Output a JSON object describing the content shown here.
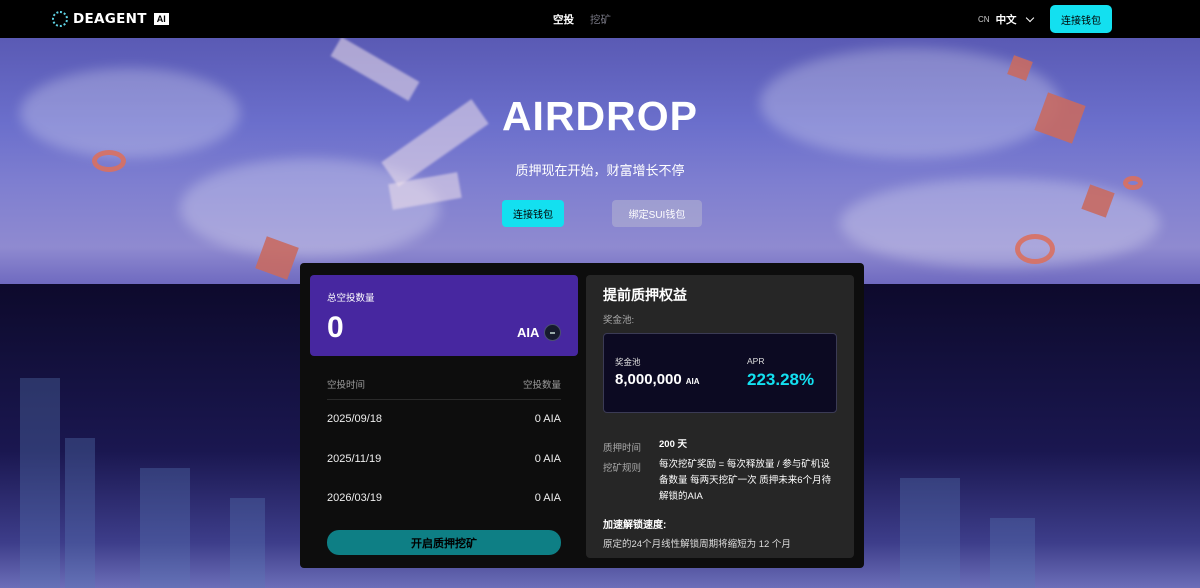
{
  "header": {
    "brand": "DEAGENT",
    "brand_badge": "AI",
    "nav": [
      "空投",
      "挖矿"
    ],
    "lang_code": "CN",
    "lang_name": "中文",
    "connect_label": "连接钱包"
  },
  "hero": {
    "title": "AIRDROP",
    "subtitle": "质押现在开始，财富增长不停",
    "primary_button": "连接钱包",
    "secondary_button": "绑定SUI钱包"
  },
  "airdrop_card": {
    "total_label": "总空投数量",
    "total_value": "0",
    "unit": "AIA",
    "col_time": "空投时间",
    "col_amount": "空投数量",
    "rows": [
      {
        "date": "2025/09/18",
        "amount": "0 AIA"
      },
      {
        "date": "2025/11/19",
        "amount": "0 AIA"
      },
      {
        "date": "2026/03/19",
        "amount": "0 AIA"
      }
    ],
    "stake_button": "开启质押挖矿"
  },
  "benefits": {
    "title": "提前质押权益",
    "pool_label": "奖金池:",
    "pool_key": "奖金池",
    "pool_value": "8,000,000",
    "pool_unit": "AIA",
    "apr_key": "APR",
    "apr_value": "223.28%",
    "stake_time_key": "质押时间",
    "stake_time_value": "200 天",
    "rule_key": "挖矿规则",
    "rule_value": "每次挖矿奖励 = 每次释放量 / 参与矿机设备数量 每两天挖矿一次 质押未来6个月待解锁的AIA",
    "accel_title": "加速解锁速度:",
    "accel_text": "原定的24个月线性解锁周期将缩短为 12 个月"
  },
  "colors": {
    "accent": "#13e0f0",
    "card_purple": "#4727a0",
    "stake_button": "#0e7f85"
  }
}
